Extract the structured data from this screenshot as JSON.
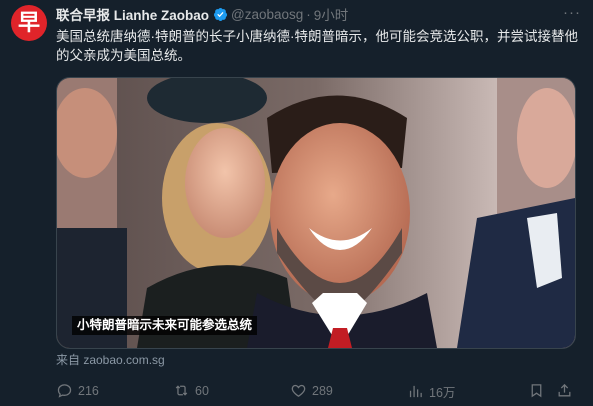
{
  "author": {
    "display_name": "联合早报 Lianhe Zaobao",
    "handle": "@zaobaosg",
    "separator": "·",
    "time": "9小时",
    "avatar_glyph": "早",
    "avatar_color": "#e0242a",
    "verified": true,
    "verified_color": "#1d9bf0"
  },
  "more_icon": "more-icon",
  "tweet": {
    "text": "美国总统唐纳德·特朗普的长子小唐纳德·特朗普暗示，他可能会竞选公职，并尝试接替他的父亲成为美国总统。"
  },
  "media": {
    "caption": "小特朗普暗示未来可能参选总统"
  },
  "source": {
    "text": "来自 zaobao.com.sg"
  },
  "actions": {
    "replies": "216",
    "retweets": "60",
    "likes": "289",
    "views": "16万"
  },
  "colors": {
    "background": "#15202b",
    "text": "#e7e9ea",
    "muted": "#71767b",
    "border": "#38444d"
  }
}
